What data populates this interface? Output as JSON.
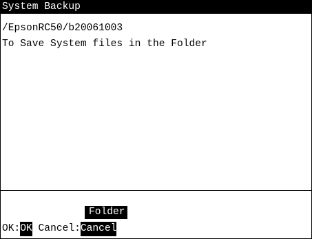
{
  "window": {
    "title": "System Backup"
  },
  "content": {
    "path": "/EpsonRC50/b20061003",
    "message": "To Save System files in the Folder"
  },
  "footer": {
    "folder_button": "Folder",
    "ok_prefix": "OK:",
    "ok_key": "OK",
    "cancel_prefix": " Cancel:",
    "cancel_key": "Cancel"
  },
  "colors": {
    "background": "#ffffff",
    "foreground": "#000000",
    "highlight": "#000000"
  }
}
